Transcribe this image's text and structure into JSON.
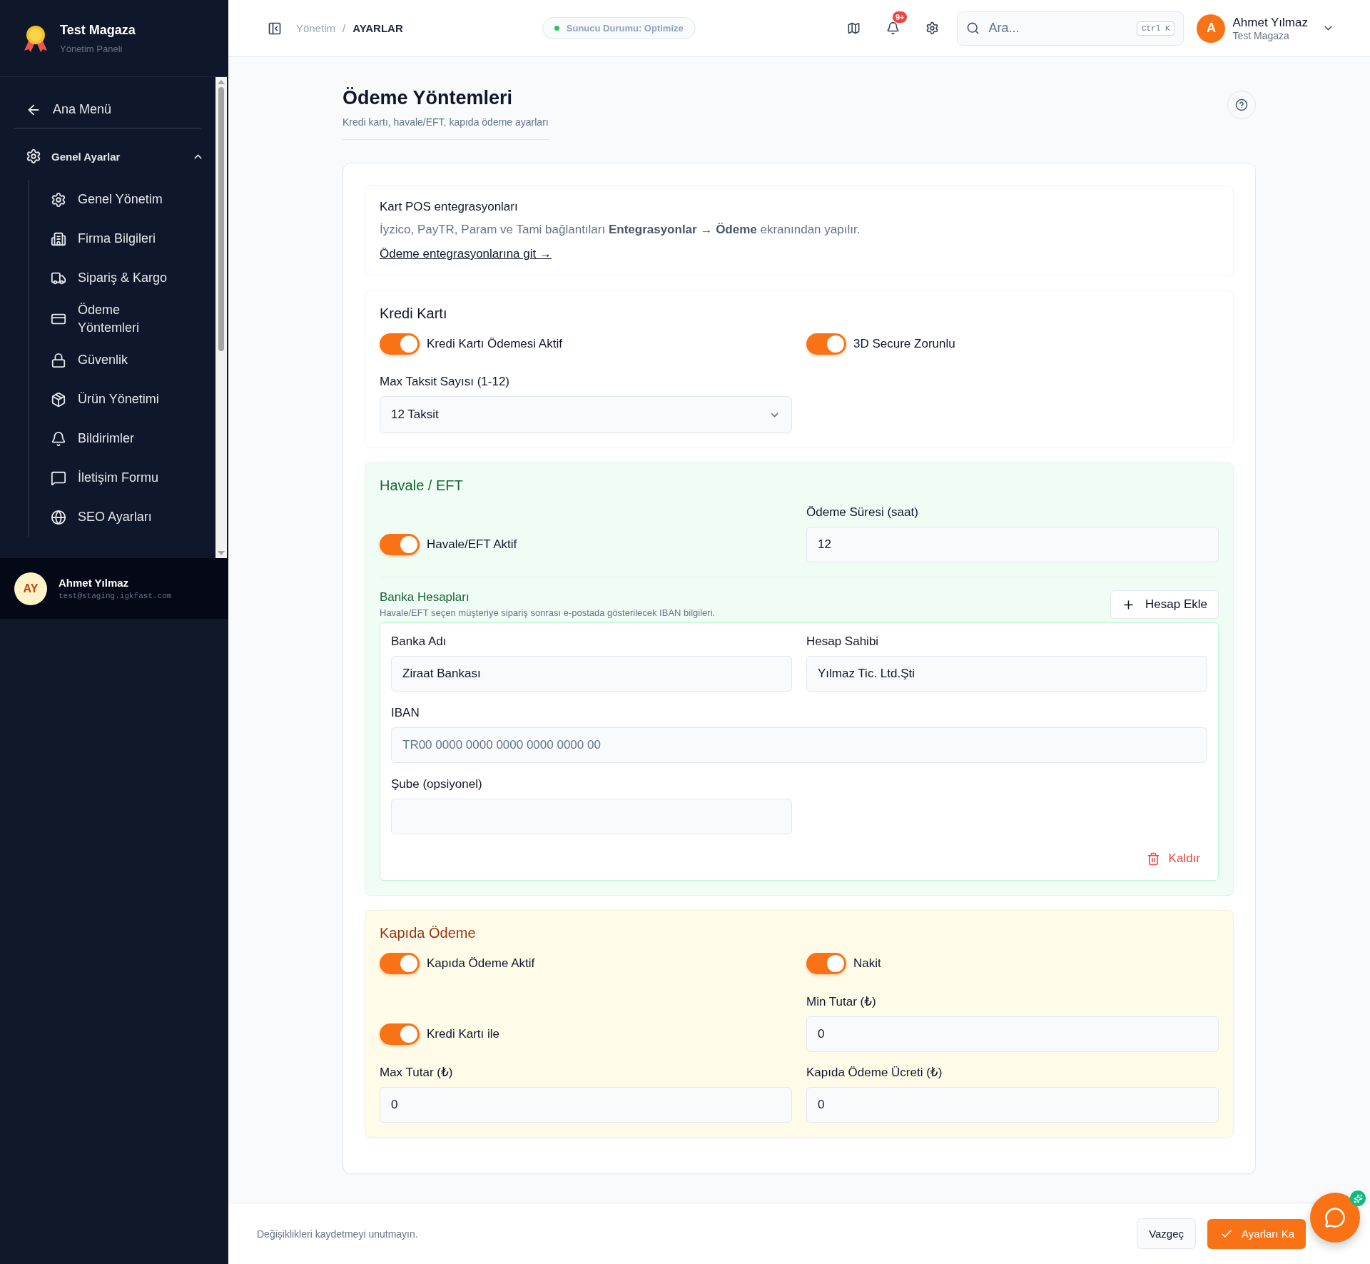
{
  "sidebar": {
    "brand": {
      "title": "Test Magaza",
      "subtitle": "Yönetim Paneli"
    },
    "back": "Ana Menü",
    "group": {
      "label": "Genel Ayarlar",
      "expanded": true,
      "items": [
        {
          "label": "Genel Yönetim"
        },
        {
          "label": "Firma Bilgileri"
        },
        {
          "label": "Sipariş & Kargo"
        },
        {
          "label": "Ödeme Yöntemleri"
        },
        {
          "label": "Güvenlik"
        },
        {
          "label": "Ürün Yönetimi"
        },
        {
          "label": "Bildirimler"
        },
        {
          "label": "İletişim Formu"
        },
        {
          "label": "SEO Ayarları"
        }
      ]
    },
    "user": {
      "initials": "AY",
      "name": "Ahmet Yılmaz",
      "email": "test@staging.igkfast.com"
    }
  },
  "topbar": {
    "breadcrumb": [
      "Yönetim",
      "AYARLAR"
    ],
    "separator": "/",
    "status": "Sunucu Durumu: Optimize",
    "notifications": "9+",
    "search": {
      "placeholder": "Ara...",
      "shortcut": "Ctrl K"
    },
    "user": {
      "initial": "A",
      "name": "Ahmet Yılmaz",
      "store": "Test Magaza"
    }
  },
  "page": {
    "title": "Ödeme Yöntemleri",
    "subtitle": "Kredi kartı, havale/EFT, kapıda ödeme ayarları"
  },
  "info": {
    "title": "Kart POS entegrasyonları",
    "text": "İyzico, PayTR, Param ve Tami bağlantıları **Entegrasyonlar → Ödeme** ekranından yapılır.",
    "link": "Ödeme entegrasyonlarına git →"
  },
  "sections": [
    {
      "title": "Kredi Kartı",
      "color": "#ffffff",
      "rows": [
        [
          {
            "kind": "toggle",
            "label": "Kredi Kartı Ödemesi Aktif",
            "on": true
          },
          {
            "kind": "toggle",
            "label": "3D Secure Zorunlu",
            "on": true
          }
        ],
        [
          {
            "kind": "select",
            "label": "Max Taksit Sayısı (1-12)",
            "value": "12 Taksit"
          }
        ]
      ]
    },
    {
      "title": "Havale / EFT",
      "color": "#f0fdf4",
      "rows": [
        [
          {
            "kind": "toggle",
            "label": "Havale/EFT Aktif",
            "on": true
          },
          {
            "kind": "input",
            "label": "Ödeme Süresi (saat)",
            "value": "12"
          }
        ]
      ],
      "banks": {
        "title": "Banka Hesapları",
        "hint": "Havale/EFT seçen müşteriye sipariş sonrası e-postada gösterilecek IBAN bilgileri.",
        "add": "Hesap Ekle",
        "remove": "Kaldır",
        "accounts": [
          {
            "rows": [
              [
                {
                  "kind": "input",
                  "label": "Banka Adı",
                  "value": "Ziraat Bankası"
                },
                {
                  "kind": "input",
                  "label": "Hesap Sahibi",
                  "value": "Yılmaz Tic. Ltd.Şti"
                }
              ],
              [
                {
                  "kind": "wide_input",
                  "label": "IBAN",
                  "placeholder": "TR00 0000 0000 0000 0000 0000 00"
                }
              ],
              [
                {
                  "kind": "input",
                  "label": "Şube (opsiyonel)"
                }
              ]
            ]
          }
        ]
      }
    },
    {
      "title": "Kapıda Ödeme",
      "color": "#fefce8",
      "rows": [
        [
          {
            "kind": "toggle",
            "label": "Kapıda Ödeme Aktif",
            "on": true
          },
          {
            "kind": "toggle",
            "label": "Nakit",
            "on": true
          }
        ],
        [
          {
            "kind": "toggle",
            "label": "Kredi Kartı ile",
            "on": true
          },
          {
            "kind": "input",
            "label": "Min Tutar (₺)",
            "value": "0"
          }
        ],
        [
          {
            "kind": "input",
            "label": "Max Tutar (₺)",
            "value": "0"
          },
          {
            "kind": "input",
            "label": "Kapıda Ödeme Ücreti (₺)",
            "value": "0"
          }
        ]
      ]
    }
  ],
  "footer": {
    "note": "Değişiklikleri kaydetmeyi unutmayın.",
    "cancel": "Vazgeç",
    "save": "Ayarları Ka"
  }
}
